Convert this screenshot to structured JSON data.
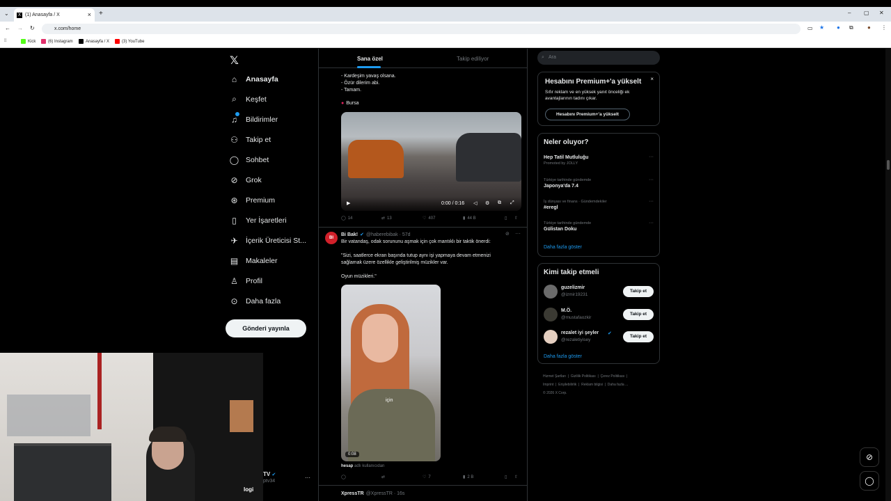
{
  "browser": {
    "tab_title": "(1) Anasayfa / X",
    "url": "x.com/home",
    "bookmarks": [
      {
        "label": "Kick",
        "color": "#53fc18"
      },
      {
        "label": "(6) Instagram",
        "color": "#e1306c"
      },
      {
        "label": "Anasayfa / X",
        "color": "#000000"
      },
      {
        "label": "(3) YouTube",
        "color": "#ff0000"
      }
    ]
  },
  "nav": {
    "items": [
      {
        "label": "Anasayfa",
        "icon": "home-icon",
        "glyph": "⌂"
      },
      {
        "label": "Keşfet",
        "icon": "search-icon",
        "glyph": "⌕"
      },
      {
        "label": "Bildirimler",
        "icon": "bell-icon",
        "glyph": "♪"
      },
      {
        "label": "Takip et",
        "icon": "follow-icon",
        "glyph": "⚇"
      },
      {
        "label": "Sohbet",
        "icon": "chat-icon",
        "glyph": "◯"
      },
      {
        "label": "Grok",
        "icon": "grok-icon",
        "glyph": "⊘"
      },
      {
        "label": "Premium",
        "icon": "premium-icon",
        "glyph": "⊛"
      },
      {
        "label": "Yer İşaretleri",
        "icon": "bookmark-icon",
        "glyph": "▯"
      },
      {
        "label": "İçerik Üreticisi St...",
        "icon": "rocket-icon",
        "glyph": "✈"
      },
      {
        "label": "Makaleler",
        "icon": "article-icon",
        "glyph": "▤"
      },
      {
        "label": "Profil",
        "icon": "profile-icon",
        "glyph": "♙"
      },
      {
        "label": "Daha fazla",
        "icon": "more-icon",
        "glyph": "⊙"
      }
    ],
    "post_button": "Gönderi yayınla"
  },
  "feed": {
    "tabs": [
      "Sana özel",
      "Takip ediliyor"
    ],
    "tweet1": {
      "text_lines": "- Kardeşim yavaş olsana.\n- Özür dilerim abi.\n- Tamam.",
      "location": "Bursa",
      "video_time": "0:00 / 0:16",
      "stats": {
        "replies": "14",
        "reposts": "13",
        "likes": "407",
        "views": "44 B"
      }
    },
    "tweet2": {
      "name": "Bi Bak!",
      "handle": "@haberebibak · 57d",
      "text_lines": "Bir vatandaş, odak sorununu aşmak için çok mantıklı bir taktik önerdi:\n\n\"Sizi, saatlerce ekran başında tutup aynı işi yapmaya devam etmenizi\nsağlamak üzere özellikle geliştirilmiş müzikler var.\n\nOyun müzikleri.\"",
      "video_time": "0:08",
      "video_caption": "için",
      "source_user": "hesap",
      "source_suffix": "adlı kullanıcıdan",
      "stats": {
        "replies": "",
        "reposts": "",
        "likes": "7",
        "views": "2 B"
      }
    },
    "tweet3_name": "XpressTR",
    "tweet3_handle": "@XpressTR · 16s"
  },
  "right": {
    "search_placeholder": "Ara",
    "premium": {
      "title": "Hesabını Premium+'a yükselt",
      "body": "Sıfır reklam ve en yüksek yanıt önceliği ek avantajlarının tadını çıkar.",
      "button": "Hesabını Premium+'a yükselt"
    },
    "trends": {
      "title": "Neler oluyor?",
      "items": [
        {
          "context": "Promoted by JOLLY",
          "name": "Hep Tatil Mutluluğu"
        },
        {
          "context": "Türkiye tarihinde gündemde",
          "name": "Japonya'da 7.4"
        },
        {
          "context": "İş dünyası ve finans · Gündemdekiler",
          "name": "#eregl"
        },
        {
          "context": "Türkiye tarihinde gündemde",
          "name": "Gülistan Doku"
        }
      ],
      "more": "Daha fazla göster"
    },
    "who_to_follow": {
      "title": "Kimi takip etmeli",
      "users": [
        {
          "name": "guzelizmir",
          "handle": "@izmir19231",
          "button": "Takip et"
        },
        {
          "name": "M.Ö.",
          "handle": "@mustafaozkir",
          "button": "Takip et"
        },
        {
          "name": "rezalet iyi şeyler",
          "handle": "@rezaletiyisey",
          "button": "Takip et"
        }
      ],
      "more": "Daha fazla göster"
    },
    "footer": "Hizmet Şartları  |  Gizlilik Politikası  |  Çerez Politikası  |\nImprint  |  Erişilebilirlik  |  Reklam bilgisi  |  Daha fazla ...\n© 2026 X Corp."
  },
  "account": {
    "name": "TV",
    "handle": "ptv34",
    "overlay_text": "logi"
  }
}
